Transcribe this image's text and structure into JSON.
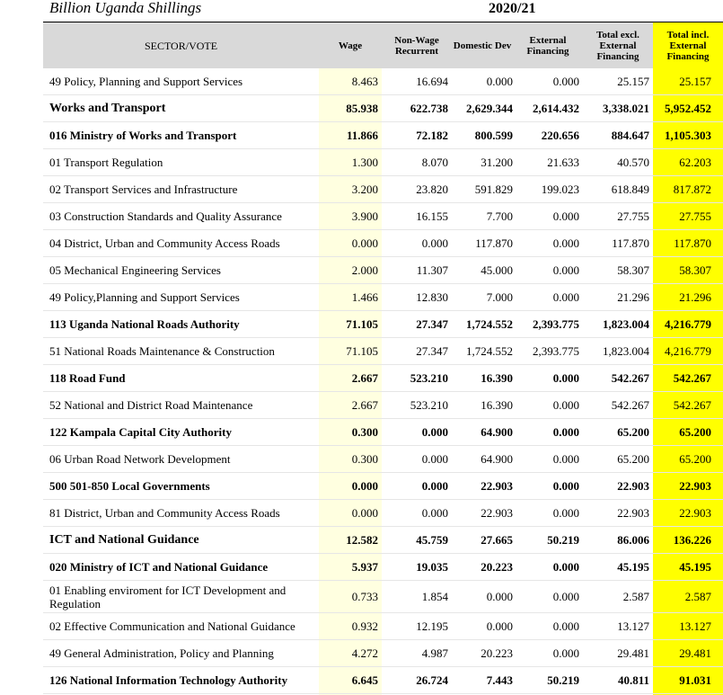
{
  "header": {
    "title": "Billion Uganda Shillings",
    "year": "2020/21",
    "columns": {
      "sector": "SECTOR/VOTE",
      "wage": "Wage",
      "nonwage": "Non-Wage Recurrent",
      "domestic": "Domestic Dev",
      "external": "External Financing",
      "total_excl": "Total excl. External Financing",
      "total_incl": "Total incl. External Financing"
    }
  },
  "rows": [
    {
      "label": "49 Policy, Planning and Support Services",
      "wage": "8.463",
      "nonwage": "16.694",
      "domestic": "0.000",
      "external": "0.000",
      "excl": "25.157",
      "incl": "25.157",
      "style": "normal"
    },
    {
      "label": "Works and Transport",
      "wage": "85.938",
      "nonwage": "622.738",
      "domestic": "2,629.344",
      "external": "2,614.432",
      "excl": "3,338.021",
      "incl": "5,952.452",
      "style": "sector"
    },
    {
      "label": "016 Ministry of Works and Transport",
      "wage": "11.866",
      "nonwage": "72.182",
      "domestic": "800.599",
      "external": "220.656",
      "excl": "884.647",
      "incl": "1,105.303",
      "style": "vote"
    },
    {
      "label": "01 Transport Regulation",
      "wage": "1.300",
      "nonwage": "8.070",
      "domestic": "31.200",
      "external": "21.633",
      "excl": "40.570",
      "incl": "62.203",
      "style": "normal"
    },
    {
      "label": "02 Transport Services and Infrastructure",
      "wage": "3.200",
      "nonwage": "23.820",
      "domestic": "591.829",
      "external": "199.023",
      "excl": "618.849",
      "incl": "817.872",
      "style": "normal"
    },
    {
      "label": "03 Construction Standards and Quality Assurance",
      "wage": "3.900",
      "nonwage": "16.155",
      "domestic": "7.700",
      "external": "0.000",
      "excl": "27.755",
      "incl": "27.755",
      "style": "normal"
    },
    {
      "label": "04 District, Urban and Community Access Roads",
      "wage": "0.000",
      "nonwage": "0.000",
      "domestic": "117.870",
      "external": "0.000",
      "excl": "117.870",
      "incl": "117.870",
      "style": "normal"
    },
    {
      "label": "05 Mechanical Engineering Services",
      "wage": "2.000",
      "nonwage": "11.307",
      "domestic": "45.000",
      "external": "0.000",
      "excl": "58.307",
      "incl": "58.307",
      "style": "normal"
    },
    {
      "label": "49 Policy,Planning and Support Services",
      "wage": "1.466",
      "nonwage": "12.830",
      "domestic": "7.000",
      "external": "0.000",
      "excl": "21.296",
      "incl": "21.296",
      "style": "normal"
    },
    {
      "label": "113 Uganda National Roads Authority",
      "wage": "71.105",
      "nonwage": "27.347",
      "domestic": "1,724.552",
      "external": "2,393.775",
      "excl": "1,823.004",
      "incl": "4,216.779",
      "style": "vote"
    },
    {
      "label": "51 National Roads Maintenance & Construction",
      "wage": "71.105",
      "nonwage": "27.347",
      "domestic": "1,724.552",
      "external": "2,393.775",
      "excl": "1,823.004",
      "incl": "4,216.779",
      "style": "normal"
    },
    {
      "label": "118 Road Fund",
      "wage": "2.667",
      "nonwage": "523.210",
      "domestic": "16.390",
      "external": "0.000",
      "excl": "542.267",
      "incl": "542.267",
      "style": "vote"
    },
    {
      "label": "52 National and District Road Maintenance",
      "wage": "2.667",
      "nonwage": "523.210",
      "domestic": "16.390",
      "external": "0.000",
      "excl": "542.267",
      "incl": "542.267",
      "style": "normal"
    },
    {
      "label": "122 Kampala Capital City Authority",
      "wage": "0.300",
      "nonwage": "0.000",
      "domestic": "64.900",
      "external": "0.000",
      "excl": "65.200",
      "incl": "65.200",
      "style": "vote"
    },
    {
      "label": "06 Urban Road Network Development",
      "wage": "0.300",
      "nonwage": "0.000",
      "domestic": "64.900",
      "external": "0.000",
      "excl": "65.200",
      "incl": "65.200",
      "style": "normal"
    },
    {
      "label": "500 501-850 Local Governments",
      "wage": "0.000",
      "nonwage": "0.000",
      "domestic": "22.903",
      "external": "0.000",
      "excl": "22.903",
      "incl": "22.903",
      "style": "vote"
    },
    {
      "label": "81 District, Urban and Community Access Roads",
      "wage": "0.000",
      "nonwage": "0.000",
      "domestic": "22.903",
      "external": "0.000",
      "excl": "22.903",
      "incl": "22.903",
      "style": "normal"
    },
    {
      "label": "ICT and National Guidance",
      "wage": "12.582",
      "nonwage": "45.759",
      "domestic": "27.665",
      "external": "50.219",
      "excl": "86.006",
      "incl": "136.226",
      "style": "sector"
    },
    {
      "label": "020 Ministry of ICT and National Guidance",
      "wage": "5.937",
      "nonwage": "19.035",
      "domestic": "20.223",
      "external": "0.000",
      "excl": "45.195",
      "incl": "45.195",
      "style": "vote"
    },
    {
      "label": "01 Enabling enviroment for ICT Development and Regulation",
      "wage": "0.733",
      "nonwage": "1.854",
      "domestic": "0.000",
      "external": "0.000",
      "excl": "2.587",
      "incl": "2.587",
      "style": "normal",
      "tall": true
    },
    {
      "label": "02 Effective Communication and National Guidance",
      "wage": "0.932",
      "nonwage": "12.195",
      "domestic": "0.000",
      "external": "0.000",
      "excl": "13.127",
      "incl": "13.127",
      "style": "normal"
    },
    {
      "label": "49 General Administration, Policy and Planning",
      "wage": "4.272",
      "nonwage": "4.987",
      "domestic": "20.223",
      "external": "0.000",
      "excl": "29.481",
      "incl": "29.481",
      "style": "normal"
    },
    {
      "label": "126 National Information Technology Authority",
      "wage": "6.645",
      "nonwage": "26.724",
      "domestic": "7.443",
      "external": "50.219",
      "excl": "40.811",
      "incl": "91.031",
      "style": "vote"
    }
  ]
}
